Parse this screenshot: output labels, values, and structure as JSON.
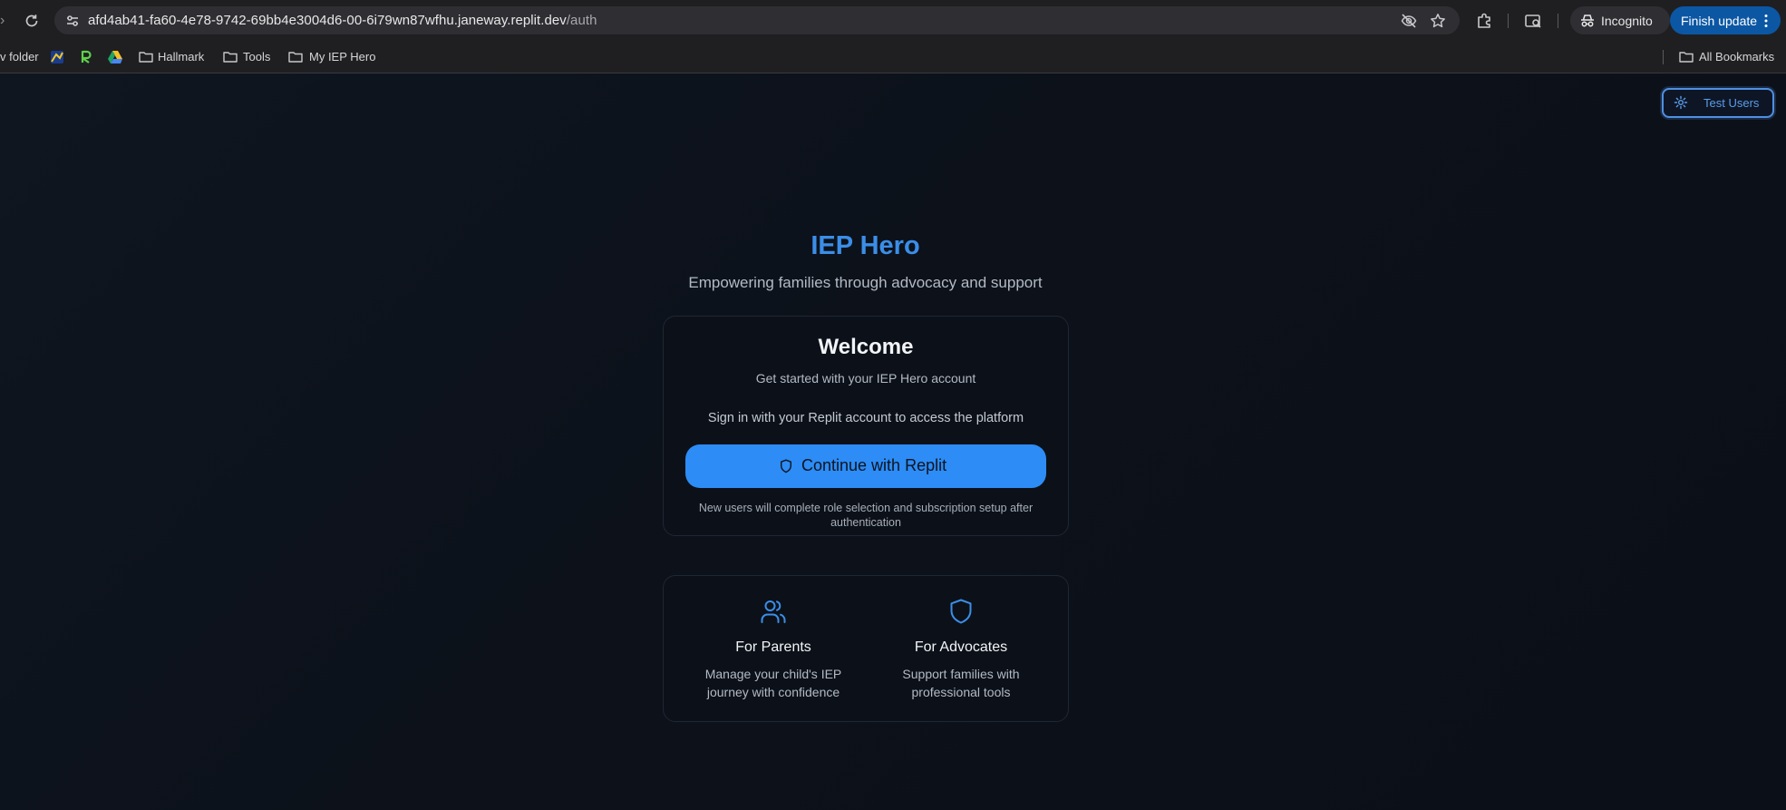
{
  "browser": {
    "bookmark_partial_folder": "v folder",
    "url_host": "afd4ab41-fa60-4e78-9742-69bb4e3004d6-00-6i79wn87wfhu.janeway.replit.dev",
    "url_path": "/auth",
    "incognito_label": "Incognito",
    "finish_update_label": "Finish update",
    "bookmarks": [
      {
        "label": "Hallmark",
        "icon": "folder-icon"
      },
      {
        "label": "Tools",
        "icon": "folder-icon"
      },
      {
        "label": "My IEP Hero",
        "icon": "folder-icon"
      }
    ],
    "all_bookmarks_label": "All Bookmarks"
  },
  "page": {
    "test_users_label": "Test Users",
    "brand_title": "IEP Hero",
    "brand_tagline": "Empowering families through advocacy and support",
    "welcome": {
      "title": "Welcome",
      "subtitle": "Get started with your IEP Hero account",
      "instruction": "Sign in with your Replit account to access the platform",
      "button_label": "Continue with Replit",
      "note": "New users will complete role selection and subscription setup after authentication"
    },
    "features": [
      {
        "icon": "users-icon",
        "title": "For Parents",
        "description": "Manage your child's IEP journey with confidence"
      },
      {
        "icon": "shield-icon",
        "title": "For Advocates",
        "description": "Support families with professional tools"
      }
    ]
  },
  "colors": {
    "accent": "#2d8cf5",
    "brand_title": "#3b8ee8",
    "page_background": "#0d1117",
    "chrome_background": "#1f1f22",
    "finish_update": "#0b57a4"
  }
}
